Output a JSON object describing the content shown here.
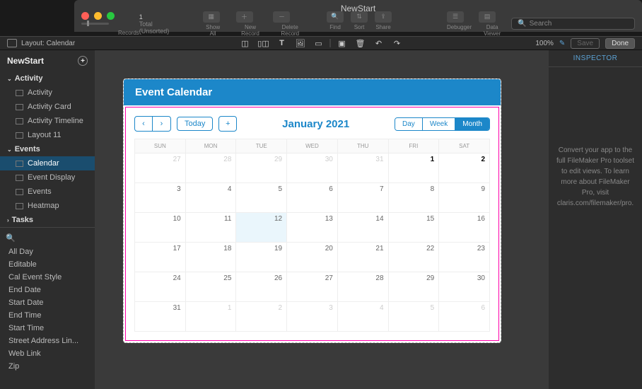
{
  "window": {
    "title": "NewStart"
  },
  "toolbar": {
    "total_label": "1",
    "total_sub": "Total (Unsorted)",
    "records_label": "Records",
    "show_all": "Show All",
    "new_record": "New Record",
    "delete_record": "Delete Record",
    "find": "Find",
    "sort": "Sort",
    "share": "Share",
    "debugger": "Debugger",
    "data_viewer": "Data Viewer",
    "search_placeholder": "Search"
  },
  "layout_bar": {
    "label": "Layout: Calendar",
    "zoom": "100%",
    "save": "Save",
    "done": "Done"
  },
  "sidebar": {
    "title": "NewStart",
    "sections": [
      {
        "name": "Activity",
        "items": [
          "Activity",
          "Activity Card",
          "Activity Timeline",
          "Layout 11"
        ]
      },
      {
        "name": "Events",
        "items": [
          "Calendar",
          "Event Display",
          "Events",
          "Heatmap"
        ]
      },
      {
        "name": "Tasks",
        "items": []
      }
    ],
    "selected_item": "Calendar",
    "fields": [
      "All Day",
      "Editable",
      "Cal Event Style",
      "End Date",
      "Start Date",
      "End Time",
      "Start Time",
      "Street Address Lin...",
      "Web Link",
      "Zip"
    ]
  },
  "inspector": {
    "title": "INSPECTOR",
    "body": "Convert your app to the full FileMaker Pro toolset to edit views. To learn more about FileMaker Pro, visit claris.com/filemaker/pro."
  },
  "calendar": {
    "header": "Event Calendar",
    "today_label": "Today",
    "title": "January 2021",
    "views": [
      "Day",
      "Week",
      "Month"
    ],
    "active_view": "Month",
    "weekdays": [
      "SUN",
      "MON",
      "TUE",
      "WED",
      "THU",
      "FRI",
      "SAT"
    ],
    "weeks": [
      [
        {
          "d": "27",
          "o": true
        },
        {
          "d": "28",
          "o": true
        },
        {
          "d": "29",
          "o": true
        },
        {
          "d": "30",
          "o": true
        },
        {
          "d": "31",
          "o": true
        },
        {
          "d": "1",
          "b": true
        },
        {
          "d": "2",
          "b": true
        }
      ],
      [
        {
          "d": "3"
        },
        {
          "d": "4"
        },
        {
          "d": "5"
        },
        {
          "d": "6"
        },
        {
          "d": "7"
        },
        {
          "d": "8"
        },
        {
          "d": "9"
        }
      ],
      [
        {
          "d": "10"
        },
        {
          "d": "11"
        },
        {
          "d": "12",
          "t": true
        },
        {
          "d": "13"
        },
        {
          "d": "14"
        },
        {
          "d": "15"
        },
        {
          "d": "16"
        }
      ],
      [
        {
          "d": "17"
        },
        {
          "d": "18"
        },
        {
          "d": "19"
        },
        {
          "d": "20"
        },
        {
          "d": "21"
        },
        {
          "d": "22"
        },
        {
          "d": "23"
        }
      ],
      [
        {
          "d": "24"
        },
        {
          "d": "25"
        },
        {
          "d": "26"
        },
        {
          "d": "27"
        },
        {
          "d": "28"
        },
        {
          "d": "29"
        },
        {
          "d": "30"
        }
      ],
      [
        {
          "d": "31"
        },
        {
          "d": "1",
          "o": true
        },
        {
          "d": "2",
          "o": true
        },
        {
          "d": "3",
          "o": true
        },
        {
          "d": "4",
          "o": true
        },
        {
          "d": "5",
          "o": true
        },
        {
          "d": "6",
          "o": true
        }
      ]
    ]
  }
}
